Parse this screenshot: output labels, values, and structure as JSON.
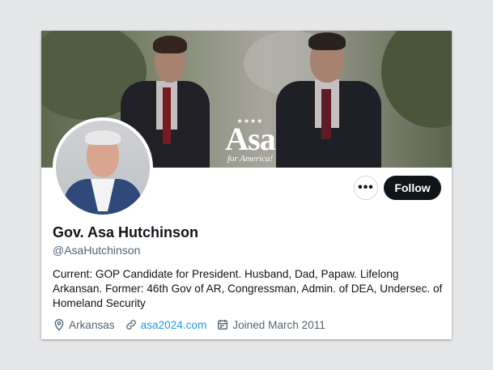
{
  "profile": {
    "banner": {
      "logo_stars": "★★★★",
      "logo_name": "Asa",
      "logo_tagline": "for America!"
    },
    "actions": {
      "more_label": "•••",
      "follow_label": "Follow"
    },
    "display_name": "Gov. Asa Hutchinson",
    "handle": "@AsaHutchinson",
    "bio": "Current: GOP Candidate for President. Husband, Dad, Papaw. Lifelong Arkansan. Former: 46th Gov of AR, Congressman, Admin. of DEA, Undersec. of Homeland Security",
    "meta": {
      "location": "Arkansas",
      "website": "asa2024.com",
      "joined": "Joined March 2011"
    },
    "icons": {
      "location": "location-pin-icon",
      "website": "link-icon",
      "joined": "calendar-icon"
    },
    "colors": {
      "follow_bg": "#0f1419",
      "link": "#1d9bf0",
      "secondary_text": "#536471"
    }
  }
}
